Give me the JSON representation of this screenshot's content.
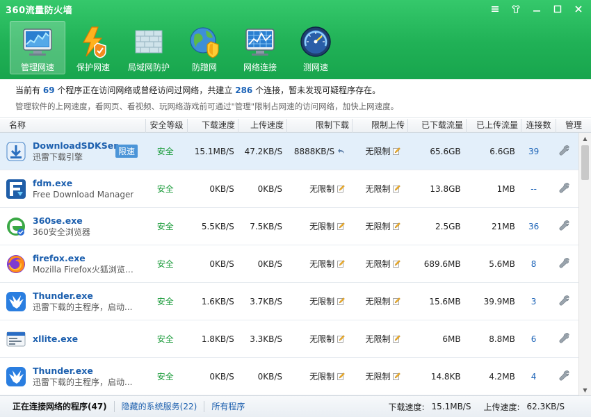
{
  "app": {
    "title": "360流量防火墙"
  },
  "window_controls": [
    {
      "name": "menu",
      "glyph": "≡"
    },
    {
      "name": "skin",
      "glyph": "👕"
    },
    {
      "name": "minimize",
      "glyph": "—"
    },
    {
      "name": "maximize",
      "glyph": "□"
    },
    {
      "name": "close",
      "glyph": "✕"
    }
  ],
  "toolbar": [
    {
      "label": "管理网速",
      "icon": "monitor-chart-icon",
      "active": true
    },
    {
      "label": "保护网速",
      "icon": "lightning-shield-icon",
      "active": false
    },
    {
      "label": "局域网防护",
      "icon": "brick-wall-icon",
      "active": false
    },
    {
      "label": "防蹭网",
      "icon": "globe-shield-icon",
      "active": false
    },
    {
      "label": "网络连接",
      "icon": "network-monitor-icon",
      "active": false
    },
    {
      "label": "测网速",
      "icon": "speedometer-icon",
      "active": false
    }
  ],
  "info": {
    "l1_a": "当前有",
    "programs": "69",
    "l1_b": "个程序正在访问网络或曾经访问过网络，共建立",
    "connections": "286",
    "l1_c": "个连接，暂未发现可疑程序存在。",
    "l2": "管理软件的上网速度，看网页、看视频、玩网络游戏前可通过\"管理\"限制占网速的访问网络，加快上网速度。"
  },
  "columns": [
    "名称",
    "安全等级",
    "下载速度",
    "上传速度",
    "限制下载",
    "限制上传",
    "已下载流量",
    "已上传流量",
    "连接数",
    "管理"
  ],
  "rows": [
    {
      "name": "DownloadSDKSer...",
      "desc": "迅雷下载引擎",
      "badge": "限速",
      "security": "安全",
      "dl": "15.1MB/S",
      "ul": "47.2KB/S",
      "limit_dl": "8888KB/S",
      "limit_dl_icon": "undo-icon",
      "limit_ul": "无限制",
      "dl_total": "65.6GB",
      "ul_total": "6.6GB",
      "conn": "39",
      "icon": "download-sdk-icon",
      "selected": true
    },
    {
      "name": "fdm.exe",
      "desc": "Free Download Manager",
      "badge": "",
      "security": "安全",
      "dl": "0KB/S",
      "ul": "0KB/S",
      "limit_dl": "无限制",
      "limit_dl_icon": "edit-icon",
      "limit_ul": "无限制",
      "dl_total": "13.8GB",
      "ul_total": "1MB",
      "conn": "--",
      "icon": "fdm-icon",
      "selected": false
    },
    {
      "name": "360se.exe",
      "desc": "360安全浏览器",
      "badge": "",
      "security": "安全",
      "dl": "5.5KB/S",
      "ul": "7.5KB/S",
      "limit_dl": "无限制",
      "limit_dl_icon": "edit-icon",
      "limit_ul": "无限制",
      "dl_total": "2.5GB",
      "ul_total": "21MB",
      "conn": "36",
      "icon": "360se-icon",
      "selected": false
    },
    {
      "name": "firefox.exe",
      "desc": "Mozilla Firefox火狐浏览器...",
      "badge": "",
      "security": "安全",
      "dl": "0KB/S",
      "ul": "0KB/S",
      "limit_dl": "无限制",
      "limit_dl_icon": "edit-icon",
      "limit_ul": "无限制",
      "dl_total": "689.6MB",
      "ul_total": "5.6MB",
      "conn": "8",
      "icon": "firefox-icon",
      "selected": false
    },
    {
      "name": "Thunder.exe",
      "desc": "迅雷下载的主程序，启动...",
      "badge": "",
      "security": "安全",
      "dl": "1.6KB/S",
      "ul": "3.7KB/S",
      "limit_dl": "无限制",
      "limit_dl_icon": "edit-icon",
      "limit_ul": "无限制",
      "dl_total": "15.6MB",
      "ul_total": "39.9MB",
      "conn": "3",
      "icon": "thunder-icon",
      "selected": false
    },
    {
      "name": "xllite.exe",
      "desc": "",
      "badge": "",
      "security": "安全",
      "dl": "1.8KB/S",
      "ul": "3.3KB/S",
      "limit_dl": "无限制",
      "limit_dl_icon": "edit-icon",
      "limit_ul": "无限制",
      "dl_total": "6MB",
      "ul_total": "8.8MB",
      "conn": "6",
      "icon": "xllite-icon",
      "selected": false
    },
    {
      "name": "Thunder.exe",
      "desc": "迅雷下载的主程序，启动...",
      "badge": "",
      "security": "安全",
      "dl": "0KB/S",
      "ul": "0KB/S",
      "limit_dl": "无限制",
      "limit_dl_icon": "edit-icon",
      "limit_ul": "无限制",
      "dl_total": "14.8KB",
      "ul_total": "4.2MB",
      "conn": "4",
      "icon": "thunder-icon",
      "selected": false
    }
  ],
  "status": {
    "tab_active": "正在连接网络的程序(47)",
    "tab_hidden": "隐藏的系统服务(22)",
    "tab_all": "所有程序",
    "dl_label": "下载速度:",
    "dl_value": "15.1MB/S",
    "ul_label": "上传速度:",
    "ul_value": "62.3KB/S"
  },
  "colors": {
    "header_green": "#20b156",
    "link_blue": "#1c63b7",
    "safe_green": "#1a9b3a",
    "badge_blue": "#4c95d8"
  }
}
